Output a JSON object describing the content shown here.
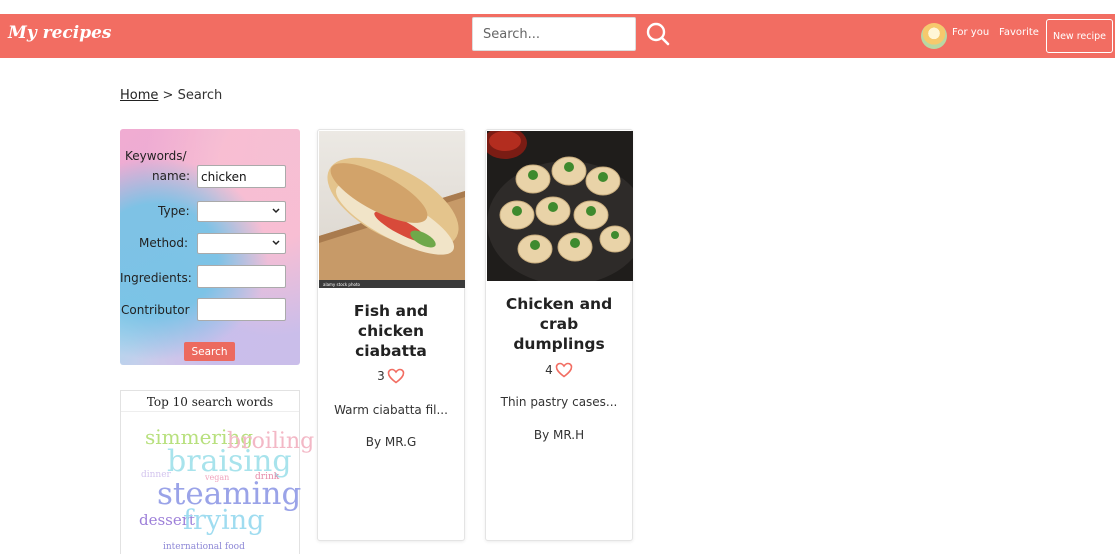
{
  "header": {
    "brand": "My recipes",
    "search_placeholder": "Search...",
    "nav_for_you": "For you",
    "nav_favorite": "Favorite",
    "new_recipe": "New recipe",
    "bg_color": "#f26d62"
  },
  "breadcrumb": {
    "home": "Home",
    "separator": " > ",
    "current": "Search"
  },
  "filter": {
    "keywords_label_line1": "Keywords/",
    "keywords_label_line2": "name:",
    "keywords_value": "chicken",
    "type_label": "Type:",
    "type_value": "",
    "method_label": "Method:",
    "method_value": "",
    "ingredients_label": "Ingredients:",
    "ingredients_value": "",
    "contributor_label": "Contributor",
    "contributor_value": "",
    "search_button": "Search",
    "button_color": "#ec6a5f"
  },
  "top_words": {
    "title": "Top 10 search words",
    "words": [
      "simmering",
      "broiling",
      "braising",
      "dinner",
      "vegan",
      "drink",
      "steaming",
      "dessert",
      "frying",
      "international food"
    ]
  },
  "recipes": [
    {
      "title_lines": [
        "Fish and",
        "chicken",
        "ciabatta"
      ],
      "likes": "3",
      "description": "Warm ciabatta fil...",
      "author": "By MR.G",
      "image_icon": "sandwich-photo"
    },
    {
      "title_lines": [
        "Chicken and",
        "crab",
        "dumplings"
      ],
      "likes": "4",
      "description": "Thin pastry cases...",
      "author": "By MR.H",
      "image_icon": "dumplings-photo"
    }
  ],
  "colors": {
    "accent": "#f26d62",
    "heart": "#f26d62"
  }
}
